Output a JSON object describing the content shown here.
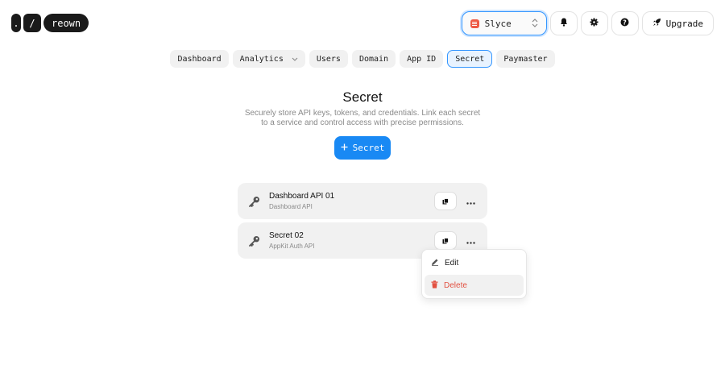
{
  "logo": {
    "dot": ".",
    "slash": "/",
    "word": "reown"
  },
  "header": {
    "project": {
      "name": "Slyce",
      "icon": "project-icon",
      "color": "#ee5a45"
    },
    "icons": [
      "bell-icon",
      "gear-icon",
      "help-icon"
    ],
    "upgrade_label": "Upgrade"
  },
  "tabs": [
    {
      "label": "Dashboard"
    },
    {
      "label": "Analytics",
      "dropdown": true
    },
    {
      "label": "Users"
    },
    {
      "label": "Domain"
    },
    {
      "label": "App ID"
    },
    {
      "label": "Secret",
      "active": true
    },
    {
      "label": "Paymaster"
    }
  ],
  "page": {
    "title": "Secret",
    "subtitle": "Securely store API keys, tokens, and credentials. Link each secret to a service and control access with precise permissions.",
    "add_button": "Secret"
  },
  "secrets": [
    {
      "name": "Dashboard API 01",
      "service": "Dashboard API"
    },
    {
      "name": "Secret 02",
      "service": "AppKit Auth API"
    }
  ],
  "menu": {
    "edit": "Edit",
    "delete": "Delete"
  },
  "colors": {
    "accent": "#1989f4",
    "danger": "#e25141"
  }
}
